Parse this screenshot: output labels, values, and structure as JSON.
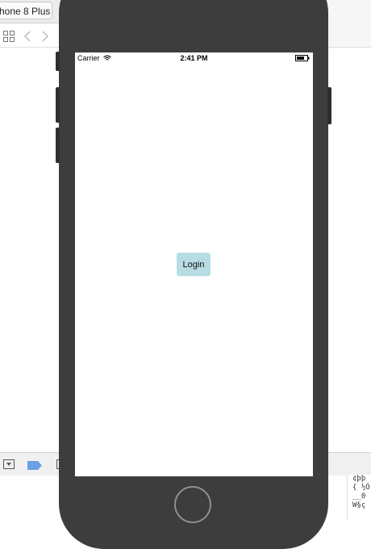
{
  "ide": {
    "device_selector_label": "hone 8 Plus",
    "console_lines": [
      "¢þþ",
      "{ ½Ó",
      "__0",
      "W§ç"
    ]
  },
  "device": {
    "status_bar": {
      "carrier": "Carrier",
      "time": "2:41 PM"
    },
    "login_button_label": "Login"
  },
  "colors": {
    "device_frame": "#3d3d3d",
    "login_button_bg": "#b8dce3",
    "screen_bg": "#ffffff"
  },
  "icons": [
    "grid-icon",
    "back-arrow-icon",
    "forward-arrow-icon",
    "wifi-icon",
    "battery-icon",
    "dropdown-icon",
    "tag-icon",
    "panel-icon"
  ]
}
